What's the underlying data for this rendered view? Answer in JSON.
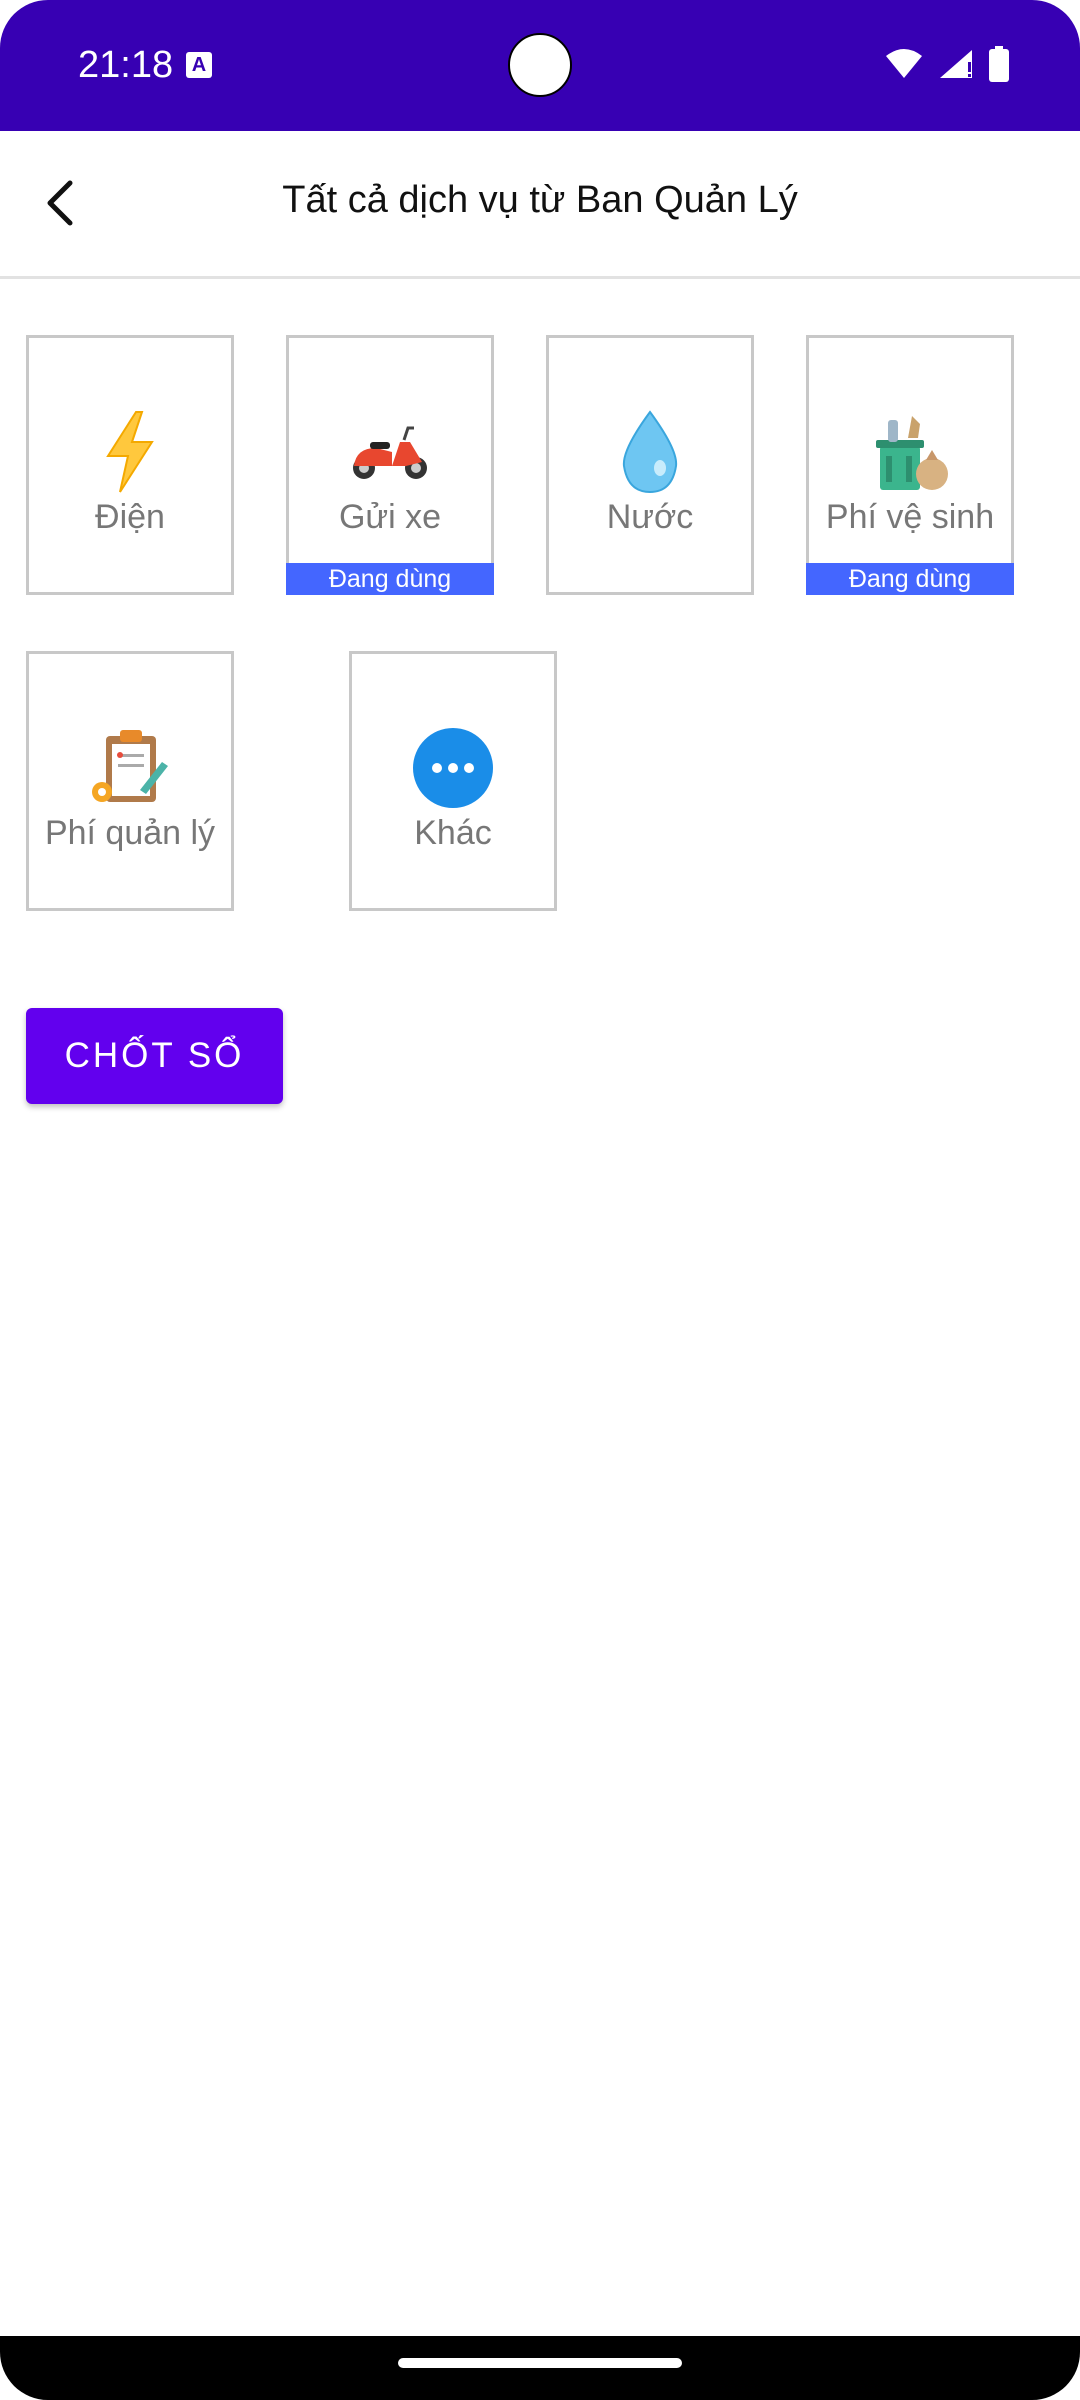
{
  "status_bar": {
    "time": "21:18",
    "notification_icon": "a-text-icon",
    "icons": [
      "wifi-icon",
      "signal-icon",
      "battery-icon"
    ],
    "background": "#3700b3"
  },
  "app_bar": {
    "title": "Tất cả dịch vụ từ Ban Quản Lý",
    "back_icon": "back-arrow-icon"
  },
  "services": [
    {
      "label": "Điện",
      "icon": "lightning-icon",
      "badge": ""
    },
    {
      "label": "Gửi xe",
      "icon": "scooter-icon",
      "badge": "Đang dùng"
    },
    {
      "label": "Nước",
      "icon": "water-drop-icon",
      "badge": ""
    },
    {
      "label": "Phí vệ sinh",
      "icon": "trash-bin-icon",
      "badge": "Đang dùng"
    },
    {
      "label": "Phí quản lý",
      "icon": "clipboard-icon",
      "badge": ""
    },
    {
      "label": "Khác",
      "icon": "more-icon",
      "badge": ""
    }
  ],
  "primary_button": {
    "label": "CHỐT SỔ"
  },
  "colors": {
    "accent": "#6200ee",
    "badge": "#4466ff",
    "status_bar": "#3700b3"
  }
}
